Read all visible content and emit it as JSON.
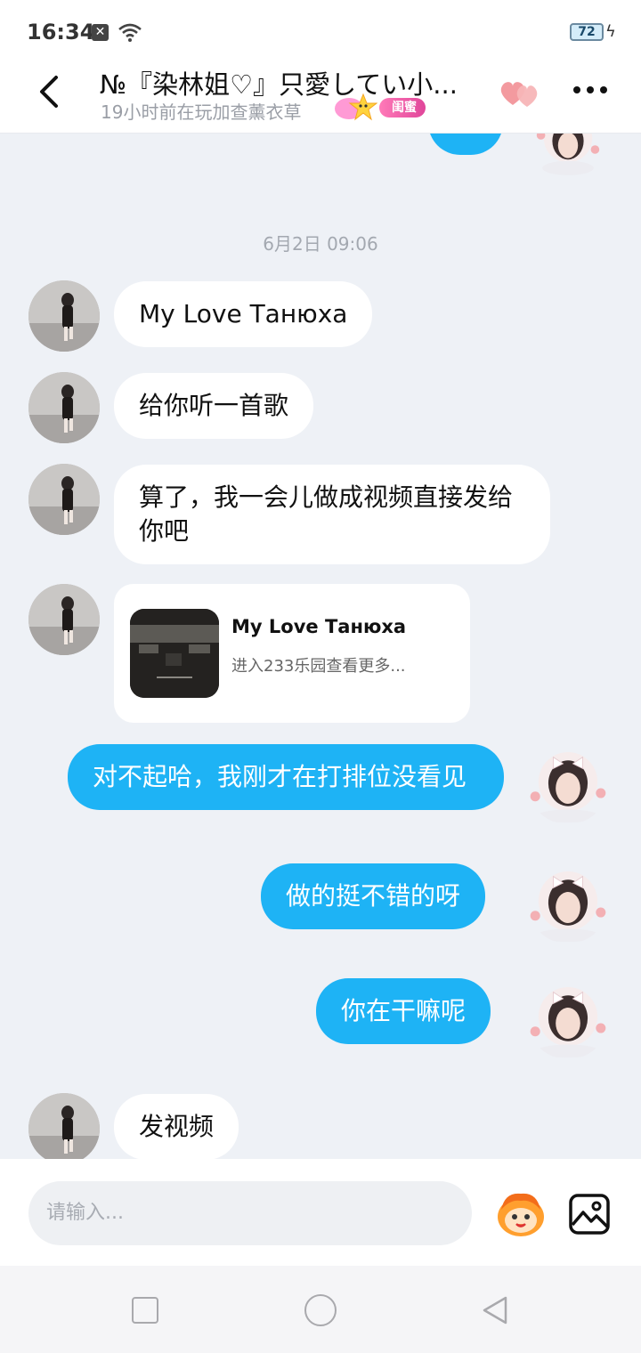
{
  "status_bar": {
    "time": "16:34",
    "notification_icon": "close-square-icon",
    "wifi_icon": "wifi-icon",
    "battery_level": "72",
    "charging_icon": "bolt-icon"
  },
  "header": {
    "title": "№『染林姐♡』只愛してい小...",
    "subtitle": "19小时前在玩加查薰衣草",
    "relation_badge": "闺蜜",
    "back_icon": "chevron-left-icon",
    "hearts_icon": "hearts-icon",
    "more_icon": "more-dots-icon"
  },
  "chat": {
    "date_divider": "6月2日 09:06",
    "messages": [
      {
        "side": "in",
        "type": "text",
        "text": "My Love Танюха"
      },
      {
        "side": "in",
        "type": "text",
        "text": "给你听一首歌"
      },
      {
        "side": "in",
        "type": "text",
        "text": "算了，我一会儿做成视频直接发给你吧"
      },
      {
        "side": "in",
        "type": "card",
        "title": "My Love Танюха",
        "subtitle": "进入233乐园查看更多..."
      },
      {
        "side": "out",
        "type": "text",
        "text": "对不起哈，我刚才在打排位没看见"
      },
      {
        "side": "out",
        "type": "text",
        "text": "做的挺不错的呀"
      },
      {
        "side": "out",
        "type": "text",
        "text": "你在干嘛呢"
      },
      {
        "side": "in",
        "type": "text",
        "text": "发视频"
      }
    ]
  },
  "input": {
    "placeholder": "请输入...",
    "emoji_icon": "emoji-face-icon",
    "image_icon": "image-icon"
  },
  "nav": {
    "recent_icon": "square-icon",
    "home_icon": "circle-icon",
    "back_icon": "triangle-back-icon"
  },
  "colors": {
    "bubble_out": "#1eb3f5",
    "bubble_in": "#ffffff",
    "chat_bg": "#eef1f6",
    "badge": "#e0459a"
  }
}
